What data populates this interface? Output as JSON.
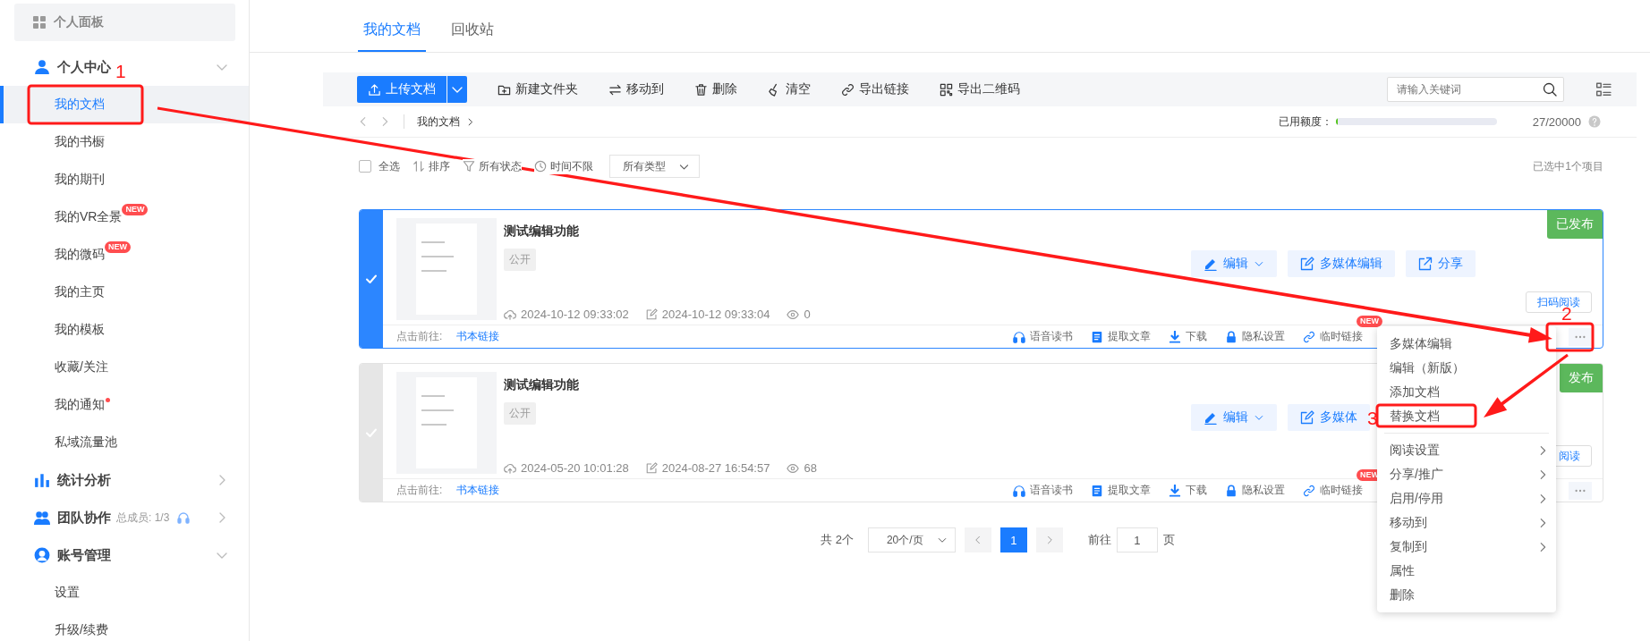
{
  "sidebar": {
    "items": [
      {
        "kind": "panel",
        "label": "个人面板"
      },
      {
        "kind": "group",
        "label": "个人中心",
        "expanded": true,
        "children": [
          {
            "label": "我的文档",
            "selected": true,
            "dot": false
          },
          {
            "label": "我的书橱",
            "selected": false,
            "dot": false
          },
          {
            "label": "我的期刊",
            "selected": false,
            "dot": false
          },
          {
            "label": "我的VR全景",
            "selected": false,
            "dot": false,
            "badge": "NEW"
          },
          {
            "label": "我的微码",
            "selected": false,
            "dot": false,
            "badge": "NEW"
          },
          {
            "label": "我的主页",
            "selected": false,
            "dot": false
          },
          {
            "label": "我的模板",
            "selected": false,
            "dot": false
          },
          {
            "label": "收藏/关注",
            "selected": false,
            "dot": false
          },
          {
            "label": "我的通知",
            "selected": false,
            "dot": true
          },
          {
            "label": "私域流量池",
            "selected": false,
            "dot": false
          }
        ]
      },
      {
        "kind": "group",
        "label": "统计分析",
        "expanded": false
      },
      {
        "kind": "group",
        "label": "团队协作",
        "note": "总成员: 1/3",
        "expanded": false
      },
      {
        "kind": "group",
        "label": "账号管理",
        "expanded": true,
        "children": [
          {
            "label": "设置",
            "selected": false,
            "dot": false
          },
          {
            "label": "升级/续费",
            "selected": false,
            "dot": false
          }
        ]
      }
    ]
  },
  "tabs": [
    {
      "label": "我的文档",
      "selected": true
    },
    {
      "label": "回收站",
      "selected": false
    }
  ],
  "toolbar": {
    "upload_button": "上传文档",
    "actions": [
      "新建文件夹",
      "移动到",
      "删除",
      "清空",
      "导出链接",
      "导出二维码"
    ],
    "search": {
      "placeholder": "请输入关键词"
    }
  },
  "breadcrumb": {
    "items": [
      "我的文档"
    ],
    "quota_label": "已用额度：",
    "quota": {
      "level": 0.01
    },
    "quota_text": "27/20000"
  },
  "filters": {
    "select_all": {
      "label": "全选",
      "checked": false
    },
    "sort": "排序",
    "status": "所有状态",
    "time": "时间不限",
    "type": "所有类型",
    "selection_info": "已选中1个项目"
  },
  "documents": [
    {
      "selected": true,
      "title": "测试编辑功能",
      "visibility": "公开",
      "uploaded": "2024-10-12 09:33:02",
      "modified": "2024-10-12 09:33:04",
      "views": "0",
      "status": "已发布",
      "actions": [
        {
          "label": "编辑",
          "dropdown": true
        },
        {
          "label": "多媒体编辑",
          "dropdown": false
        },
        {
          "label": "分享",
          "dropdown": false
        }
      ],
      "scan_button": "扫码阅读",
      "footer_label": "点击前往:",
      "footer_link": "书本链接",
      "footer_actions": [
        {
          "label": "语音读书"
        },
        {
          "label": "提取文章"
        },
        {
          "label": "下载"
        },
        {
          "label": "隐私设置"
        },
        {
          "label": "临时链接",
          "badge": "NEW"
        }
      ]
    },
    {
      "selected": false,
      "title": "测试编辑功能",
      "visibility": "公开",
      "uploaded": "2024-05-20 10:01:28",
      "modified": "2024-08-27 16:54:57",
      "views": "68",
      "status": "发布",
      "actions": [
        {
          "label": "编辑",
          "dropdown": true
        },
        {
          "label": "多媒体",
          "dropdown": false
        }
      ],
      "scan_button": "阅读",
      "footer_label": "点击前往:",
      "footer_link": "书本链接",
      "footer_actions": [
        {
          "label": "语音读书"
        },
        {
          "label": "提取文章"
        },
        {
          "label": "下载"
        },
        {
          "label": "隐私设置"
        },
        {
          "label": "临时链接",
          "badge": "NEW"
        }
      ]
    }
  ],
  "pagination": {
    "total": "共 2个",
    "page_size": "20个/页",
    "pages": [
      {
        "label": "1",
        "selected": true
      }
    ],
    "goto_label": "前往",
    "goto_value": "1",
    "page_unit": "页"
  },
  "context_menu": {
    "groups": [
      [
        {
          "label": "多媒体编辑",
          "submenu": false
        },
        {
          "label": "编辑（新版）",
          "submenu": false
        },
        {
          "label": "添加文档",
          "submenu": false
        },
        {
          "label": "替换文档",
          "submenu": false
        }
      ],
      [
        {
          "label": "阅读设置",
          "submenu": true
        },
        {
          "label": "分享/推广",
          "submenu": true
        },
        {
          "label": "启用/停用",
          "submenu": true
        },
        {
          "label": "移动到",
          "submenu": true
        },
        {
          "label": "复制到",
          "submenu": true
        },
        {
          "label": "属性",
          "submenu": false
        },
        {
          "label": "删除",
          "submenu": false
        }
      ]
    ]
  },
  "annotations": {
    "numbers": [
      "1",
      "2",
      "3"
    ]
  }
}
